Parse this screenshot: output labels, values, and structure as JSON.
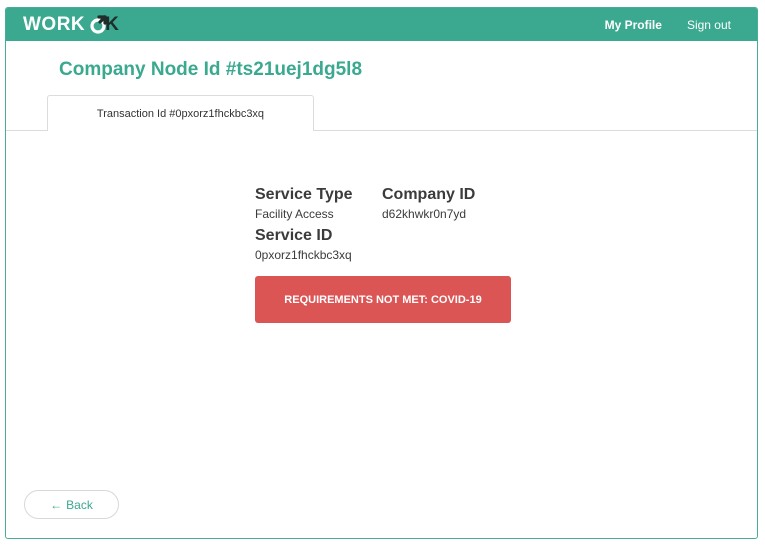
{
  "brand": {
    "name_left": "WORK",
    "name_right": "K",
    "logo_icon": "chain-link-icon",
    "accent_color": "#3aa98f",
    "alert_color": "#dc5555"
  },
  "nav": {
    "my_profile": "My Profile",
    "sign_out": "Sign out"
  },
  "page": {
    "title": "Company Node Id #ts21uej1dg5l8"
  },
  "tabs": [
    {
      "label": "Transaction Id #0pxorz1fhckbc3xq",
      "active": true
    }
  ],
  "details": {
    "service_type_label": "Service Type",
    "service_type_value": "Facility Access",
    "company_id_label": "Company ID",
    "company_id_value": "d62khwkr0n7yd",
    "service_id_label": "Service ID",
    "service_id_value": "0pxorz1fhckbc3xq"
  },
  "status": {
    "message": "REQUIREMENTS NOT MET: COVID-19"
  },
  "back_button": {
    "arrow": "←",
    "label": "Back"
  }
}
